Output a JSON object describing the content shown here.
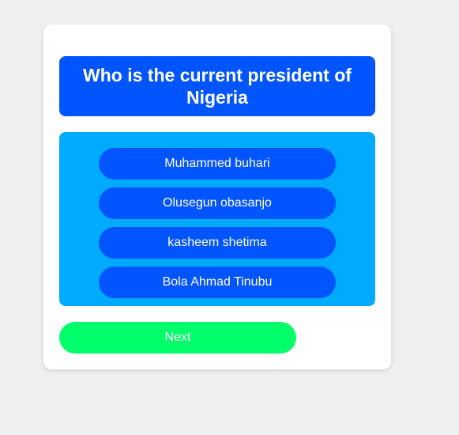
{
  "quiz": {
    "question": "Who is the current president of Nigeria",
    "options": [
      {
        "label": "Muhammed buhari"
      },
      {
        "label": "Olusegun obasanjo"
      },
      {
        "label": "kasheem shetima"
      },
      {
        "label": "Bola Ahmad Tinubu"
      }
    ],
    "next_label": "Next"
  },
  "colors": {
    "page_background": "#efefef",
    "card_background": "#ffffff",
    "question_background": "#0055ff",
    "options_panel_background": "#00aaff",
    "option_button_background": "#0055ff",
    "next_button_background": "#00ff6a",
    "text": "#ffffff"
  }
}
